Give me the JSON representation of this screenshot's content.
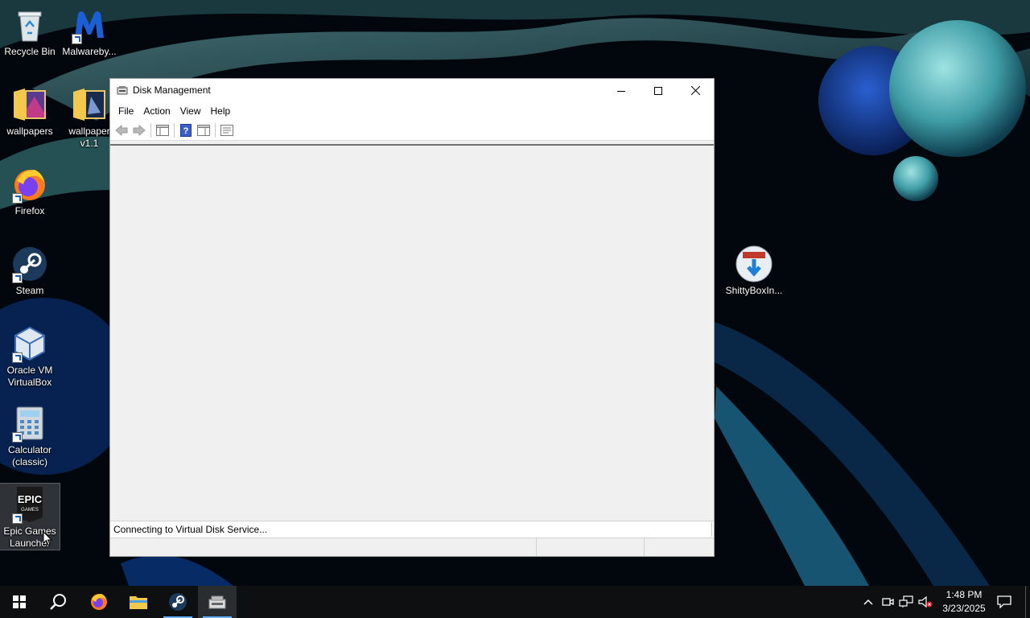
{
  "desktop": {
    "icons": [
      {
        "label": "Recycle Bin",
        "icon": "recycle-bin-icon"
      },
      {
        "label": "Malwareby...",
        "icon": "malwarebytes-icon"
      },
      {
        "label": "wallpapers",
        "icon": "folder-icon"
      },
      {
        "label": "wallpaper v1.1",
        "icon": "folder-icon"
      },
      {
        "label": "Firefox",
        "icon": "firefox-icon"
      },
      {
        "label": "Steam",
        "icon": "steam-icon"
      },
      {
        "label": "Oracle VM VirtualBox",
        "icon": "virtualbox-icon"
      },
      {
        "label": "Calculator (classic)",
        "icon": "calculator-icon"
      },
      {
        "label": "Epic Games Launcher",
        "icon": "epic-games-icon"
      },
      {
        "label": "ShittyBoxIn...",
        "icon": "installer-icon"
      }
    ]
  },
  "window": {
    "title": "Disk Management",
    "menu": [
      "File",
      "Action",
      "View",
      "Help"
    ],
    "status": "Connecting to Virtual Disk Service..."
  },
  "taskbar": {
    "time": "1:48 PM",
    "date": "3/23/2025"
  },
  "colors": {
    "accent": "#6ab0ff",
    "taskbar": "#0d0f10"
  }
}
